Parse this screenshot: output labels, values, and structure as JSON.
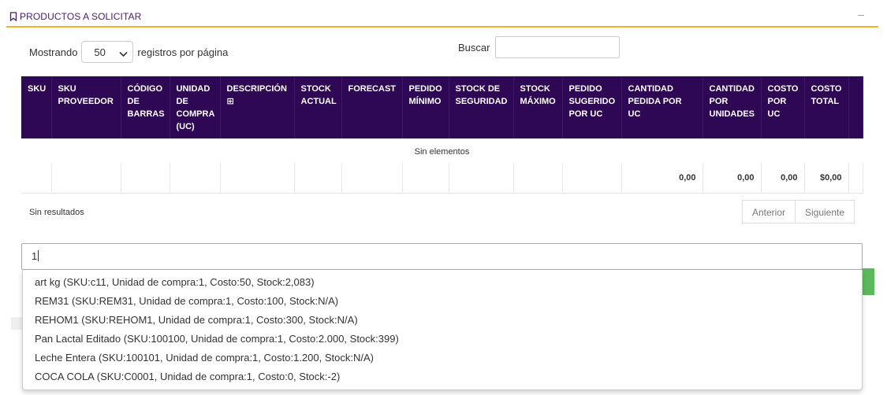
{
  "panel": {
    "title": "PRODUCTOS A SOLICITAR",
    "collapse": "–"
  },
  "length": {
    "prefix": "Mostrando",
    "value": "50",
    "suffix": "registros por página"
  },
  "search": {
    "label": "Buscar",
    "value": ""
  },
  "table": {
    "headers": [
      "SKU",
      "SKU PROVEEDOR",
      "CÓDIGO DE BARRAS",
      "UNIDAD DE COMPRA (UC)",
      "DESCRIPCIÓN ⊞",
      "STOCK ACTUAL",
      "FORECAST",
      "PEDIDO MÍNIMO",
      "STOCK DE SEGURIDAD",
      "STOCK MÁXIMO",
      "PEDIDO SUGERIDO POR UC",
      "CANTIDAD PEDIDA POR UC",
      "CANTIDAD POR UNIDADES",
      "COSTO POR UC",
      "COSTO TOTAL",
      ""
    ],
    "empty_message": "Sin elementos",
    "totals": [
      "",
      "",
      "",
      "",
      "",
      "",
      "",
      "",
      "",
      "",
      "",
      "0,00",
      "0,00",
      "0,00",
      "$0,00",
      ""
    ]
  },
  "info": "Sin resultados",
  "pagination": {
    "prev": "Anterior",
    "next": "Siguiente"
  },
  "typeahead": {
    "value": "1"
  },
  "suggestions": [
    "art kg (SKU:c11, Unidad de compra:1, Costo:50, Stock:2,083)",
    "REM31 (SKU:REM31, Unidad de compra:1, Costo:100, Stock:N/A)",
    "REHOM1 (SKU:REHOM1, Unidad de compra:1, Costo:300, Stock:N/A)",
    "Pan Lactal Editado (SKU:100100, Unidad de compra:1, Costo:2.000, Stock:399)",
    "Leche Entera (SKU:100101, Unidad de compra:1, Costo:1.200, Stock:N/A)",
    "COCA COLA (SKU:C0001, Unidad de compra:1, Costo:0, Stock:-2)"
  ],
  "colors": {
    "header_bg": "#2e0854",
    "accent": "#f0b429",
    "title": "#4a1d6b",
    "success": "#5cb85c"
  }
}
